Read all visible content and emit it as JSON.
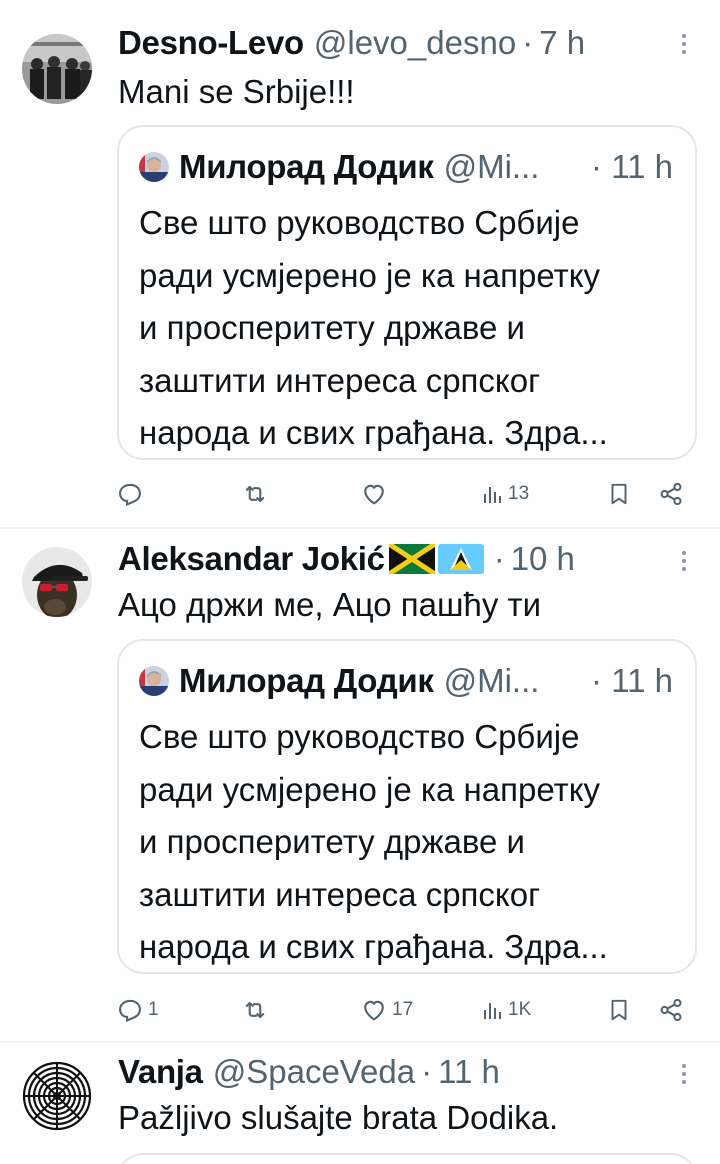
{
  "tweets": [
    {
      "name": "Desno-Levo",
      "handle": "@levo_desno",
      "dot": "·",
      "time": "7 h",
      "text": "Mani se Srbije!!!",
      "quote": {
        "name": "Милорад Додик",
        "handle": "@Mi...",
        "dot": "·",
        "time": "11 h",
        "lines": [
          "Све што руководство Србије",
          "ради усмјерено је ка напретку",
          "и просперитету државе и",
          "заштити интереса српског",
          "народа и свих грађана. Здра..."
        ]
      },
      "stats": {
        "replies": "",
        "retweets": "",
        "likes": "",
        "views": "13"
      }
    },
    {
      "name": "Aleksandar Jokić",
      "handle": "",
      "dot": "·",
      "time": "10 h",
      "flags": [
        "jamaica-flag",
        "saint-lucia-flag"
      ],
      "text": "Ацо држи ме, Ацо пашћу ти",
      "quote": {
        "name": "Милорад Додик",
        "handle": "@Mi...",
        "dot": "·",
        "time": "11 h",
        "lines": [
          "Све што руководство Србије",
          "ради усмјерено је ка напретку",
          "и просперитету државе и",
          "заштити интереса српског",
          "народа и свих грађана. Здра..."
        ]
      },
      "stats": {
        "replies": "1",
        "retweets": "",
        "likes": "17",
        "views": "1K"
      }
    },
    {
      "name": "Vanja",
      "handle": "@SpaceVeda",
      "dot": "·",
      "time": "11 h",
      "text": "Pažljivo slušajte brata Dodika."
    }
  ],
  "icons": {
    "reply": "reply-icon",
    "retweet": "retweet-icon",
    "like": "heart-icon",
    "views": "views-icon",
    "bookmark": "bookmark-icon",
    "share": "share-icon",
    "more": "more-icon"
  },
  "colors": {
    "text": "#0f1419",
    "secondary": "#536471",
    "border": "#e1e8ed",
    "divider": "#eff3f4"
  }
}
